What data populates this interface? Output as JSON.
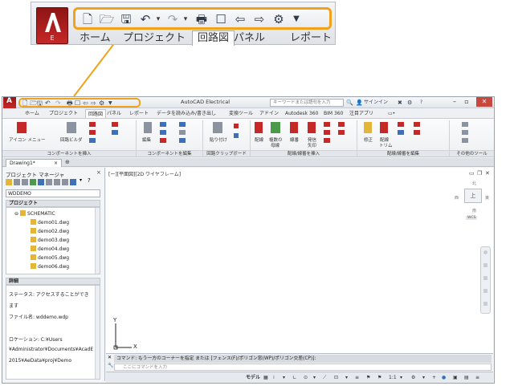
{
  "zoom": {
    "app_button_label": "E",
    "tabs": [
      "ホーム",
      "プロジェクト",
      "回路図",
      "パネル",
      "レポート"
    ],
    "active_tab": "回路図",
    "qat_icons": [
      "new-icon",
      "open-icon",
      "save-icon",
      "undo-icon",
      "redo-icon",
      "plot-icon",
      "back-icon",
      "forward-icon",
      "plugin-icon",
      "customize-icon"
    ]
  },
  "window": {
    "title": "AutoCAD Electrical",
    "search_placeholder": "キーワードまたは語句を入力",
    "signin_label": "サインイン",
    "help_label": "?"
  },
  "ribbon_tabs": [
    "ホーム",
    "プロジェクト",
    "回路図",
    "パネル",
    "レポート",
    "データを読み込み/書き出し",
    "変換ツール",
    "アドイン",
    "Autodesk 360",
    "BIM 360",
    "注目アプリ"
  ],
  "ribbon": {
    "buttons": {
      "icon_menu": "アイコン メニュー",
      "circuit_builder": "回路ビルダ",
      "edit": "編集",
      "paste": "貼り付け",
      "wire": "配線",
      "multi_bus": "複数の",
      "multi_bus_2": "母線",
      "wire_num": "線番",
      "source_arrow": "発信",
      "source_arrow_2": "矢印",
      "modify": "修正",
      "trim": "配線",
      "trim_2": "トリム"
    },
    "groups": [
      "コンポーネントを挿入",
      "コンポーネントを編集",
      "回路クリップボード",
      "配線/線番を挿入",
      "配線/線番を編集",
      "その他のツール"
    ]
  },
  "file_tab": "Drawing1*",
  "project_manager": {
    "title": "プロジェクト マネージャ",
    "close": "×",
    "selected_project": "WDDEMO",
    "projects_header": "プロジェクト",
    "tree": {
      "folder": "SCHEMATIC",
      "files": [
        "demo01.dwg",
        "demo02.dwg",
        "demo03.dwg",
        "demo04.dwg",
        "demo05.dwg",
        "demo06.dwg"
      ]
    },
    "details_header": "詳細",
    "details": [
      "ステータス: アクセスすることができ",
      "ます",
      "ファイル名: wddemo.wdp",
      "",
      "ロケーション: C:¥Users",
      "¥Administrator¥Documents¥AcadE",
      "2015¥AeData¥proj¥Demo"
    ]
  },
  "viewport": {
    "label": "[ー][平面図][2D ワイヤフレーム]",
    "viewcube": {
      "top": "上",
      "north": "北",
      "south": "南",
      "east": "東",
      "west": "西",
      "wcs": "WCS"
    },
    "ucs_x": "X",
    "ucs_y": "Y"
  },
  "command": {
    "history": "コマンド: もう一方のコーナーを指定 または [フェンス(F)/ポリゴン窓(WP)/ポリゴン交差(CP)]:",
    "placeholder": "ここにコマンドを入力"
  },
  "status": {
    "model": "モデル",
    "scale": "1:1"
  },
  "colors": {
    "accent_orange": "#f0a31a",
    "app_red": "#c62828"
  }
}
